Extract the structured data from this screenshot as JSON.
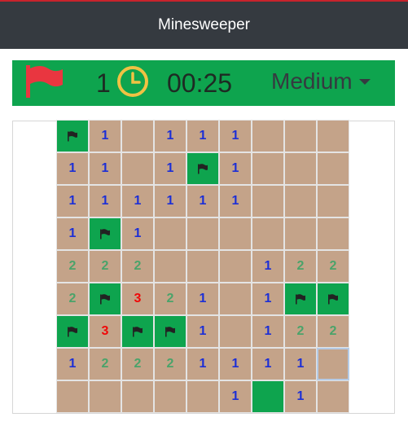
{
  "app": {
    "title": "Minesweeper"
  },
  "hud": {
    "flags_left": "1",
    "timer": "00:25",
    "difficulty": "Medium",
    "flag_icon": "red-flag-icon",
    "clock_icon": "clock-icon"
  },
  "colors": {
    "header_bg": "#353a40",
    "hud_bg": "#0ea44e",
    "cell_revealed": "#c4a389",
    "flag_cell": "#0ea44e",
    "num1": "#1c2fd6",
    "num2": "#4aa36a",
    "num3": "#f00808"
  },
  "board": {
    "rows": 9,
    "cols": 9,
    "selected": [
      7,
      8
    ],
    "cells": [
      [
        "F",
        "1",
        "",
        "1",
        "1",
        "1",
        "",
        "",
        ""
      ],
      [
        "1",
        "1",
        "",
        "1",
        "F",
        "1",
        "",
        "",
        ""
      ],
      [
        "1",
        "1",
        "1",
        "1",
        "1",
        "1",
        "",
        "",
        ""
      ],
      [
        "1",
        "F",
        "1",
        "",
        "",
        "",
        "",
        "",
        ""
      ],
      [
        "2",
        "2",
        "2",
        "",
        "",
        "",
        "1",
        "2",
        "2"
      ],
      [
        "2",
        "F",
        "3",
        "2",
        "1",
        "",
        "1",
        "F",
        "F"
      ],
      [
        "F",
        "3",
        "F",
        "F",
        "1",
        "",
        "1",
        "2",
        "2"
      ],
      [
        "1",
        "2",
        "2",
        "2",
        "1",
        "1",
        "1",
        "1",
        ""
      ],
      [
        "",
        "",
        "",
        "",
        "",
        "1",
        "G",
        "1",
        ""
      ]
    ]
  }
}
